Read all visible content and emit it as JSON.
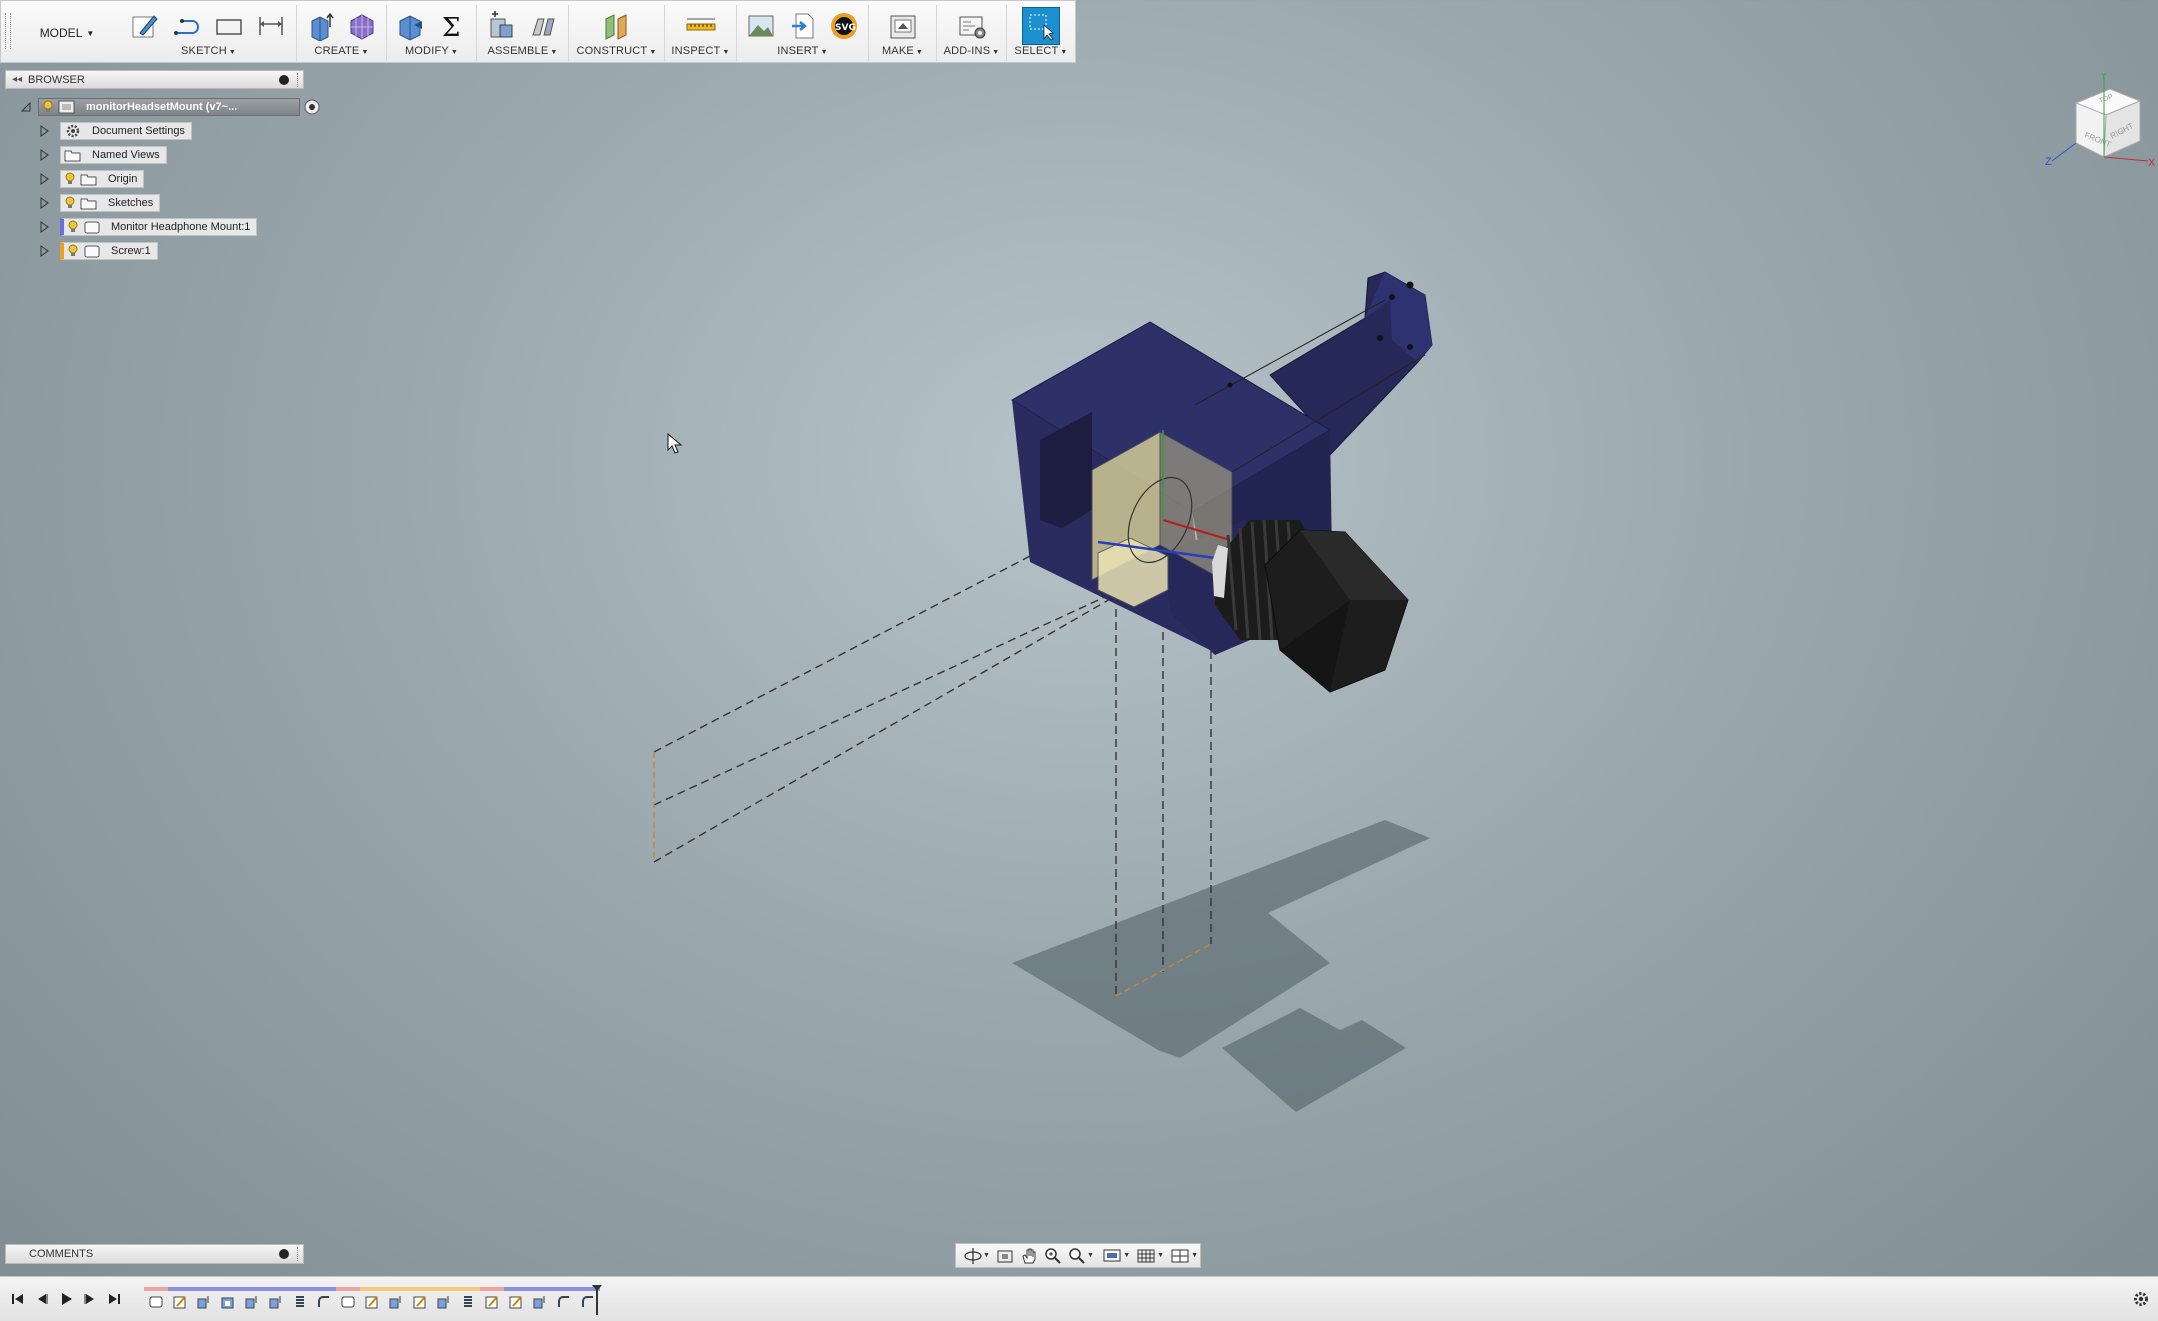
{
  "toolbar": {
    "workspace": "MODEL",
    "groups": [
      {
        "label": "SKETCH"
      },
      {
        "label": "CREATE"
      },
      {
        "label": "MODIFY"
      },
      {
        "label": "ASSEMBLE"
      },
      {
        "label": "CONSTRUCT"
      },
      {
        "label": "INSPECT"
      },
      {
        "label": "INSERT"
      },
      {
        "label": "MAKE"
      },
      {
        "label": "ADD-INS"
      },
      {
        "label": "SELECT"
      }
    ]
  },
  "browser": {
    "title": "BROWSER",
    "root": "monitorHeadsetMount (v7~...",
    "items": [
      {
        "label": "Document Settings",
        "icon": "gear-icon",
        "visible_toggle": false
      },
      {
        "label": "Named Views",
        "icon": "folder-icon",
        "visible_toggle": false
      },
      {
        "label": "Origin",
        "icon": "folder-icon",
        "visible_toggle": true
      },
      {
        "label": "Sketches",
        "icon": "folder-icon",
        "visible_toggle": true
      },
      {
        "label": "Monitor Headphone Mount:1",
        "icon": "component-icon",
        "visible_toggle": true
      },
      {
        "label": "Screw:1",
        "icon": "component-icon",
        "visible_toggle": true
      }
    ]
  },
  "comments": {
    "title": "COMMENTS"
  },
  "colors": {
    "accent": "#1b8fd0",
    "body": "#2e2f62",
    "screw": "#1a1a1a",
    "lightbulb": "#f0c53a"
  }
}
